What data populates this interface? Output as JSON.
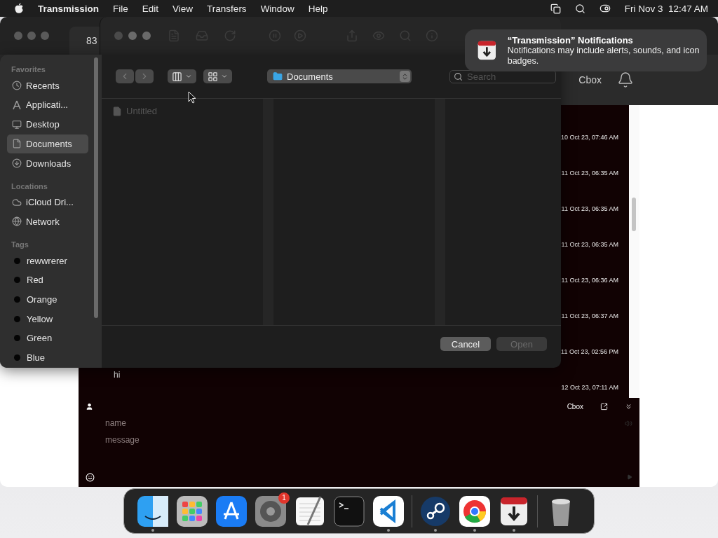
{
  "menu_bar": {
    "app_name": "Transmission",
    "menus": [
      "File",
      "Edit",
      "View",
      "Transfers",
      "Window",
      "Help"
    ],
    "clock": "Fri Nov 3  12:47 AM"
  },
  "main_window": {
    "tab_label": "83"
  },
  "cbox": {
    "header_title": "Cbox",
    "rows": [
      {
        "timestamp": "10 Oct 23, 07:46 AM"
      },
      {
        "timestamp": "11 Oct 23, 06:35 AM"
      },
      {
        "timestamp": "11 Oct 23, 06:35 AM"
      },
      {
        "timestamp": "11 Oct 23, 06:35 AM"
      },
      {
        "timestamp": "11 Oct 23, 06:36 AM"
      },
      {
        "timestamp": "11 Oct 23, 06:37 AM"
      },
      {
        "timestamp": "11 Oct 23, 02:56 PM"
      },
      {
        "message": "hi",
        "timestamp": "12 Oct 23, 07:11 AM"
      }
    ],
    "footer_title": "Cbox",
    "name_placeholder": "name",
    "message_placeholder": "message"
  },
  "open_panel": {
    "sidebar": [
      {
        "heading": "Favorites",
        "items": [
          {
            "label": "Recents",
            "kind": "recents",
            "selected": false
          },
          {
            "label": "Applicati...",
            "kind": "applications",
            "selected": false
          },
          {
            "label": "Desktop",
            "kind": "desktop",
            "selected": false
          },
          {
            "label": "Documents",
            "kind": "documents",
            "selected": true
          },
          {
            "label": "Downloads",
            "kind": "downloads",
            "selected": false
          }
        ]
      },
      {
        "heading": "Locations",
        "items": [
          {
            "label": "iCloud Dri...",
            "kind": "cloud",
            "selected": false
          },
          {
            "label": "Network",
            "kind": "network",
            "selected": false
          }
        ]
      },
      {
        "heading": "Tags",
        "items": [
          {
            "label": "rewwrerer",
            "kind": "tag",
            "selected": false
          },
          {
            "label": "Red",
            "kind": "tag",
            "selected": false
          },
          {
            "label": "Orange",
            "kind": "tag",
            "selected": false
          },
          {
            "label": "Yellow",
            "kind": "tag",
            "selected": false
          },
          {
            "label": "Green",
            "kind": "tag",
            "selected": false
          },
          {
            "label": "Blue",
            "kind": "tag",
            "selected": false
          }
        ]
      }
    ],
    "path": "Documents",
    "search_placeholder": "Search",
    "files": [
      {
        "name": "Untitled",
        "disabled": true
      }
    ],
    "buttons": [
      {
        "label": "Cancel",
        "disabled": false
      },
      {
        "label": "Open",
        "disabled": true
      }
    ]
  },
  "notification": {
    "title": "“Transmission” Notifications",
    "body": "Notifications may include alerts, sounds, and icon badges."
  },
  "dock": {
    "groups": [
      [
        {
          "kind": "finder",
          "running": true
        },
        {
          "kind": "launchpad",
          "running": false
        },
        {
          "kind": "appstore",
          "running": false
        },
        {
          "kind": "settings",
          "running": false,
          "badge": "1"
        },
        {
          "kind": "textedit",
          "running": false
        },
        {
          "kind": "terminal",
          "running": false
        },
        {
          "kind": "vscode",
          "running": true
        }
      ],
      [
        {
          "kind": "steam",
          "running": true
        },
        {
          "kind": "chrome",
          "running": true
        },
        {
          "kind": "transmission",
          "running": true
        }
      ],
      [
        {
          "kind": "trash",
          "running": false
        }
      ]
    ]
  }
}
